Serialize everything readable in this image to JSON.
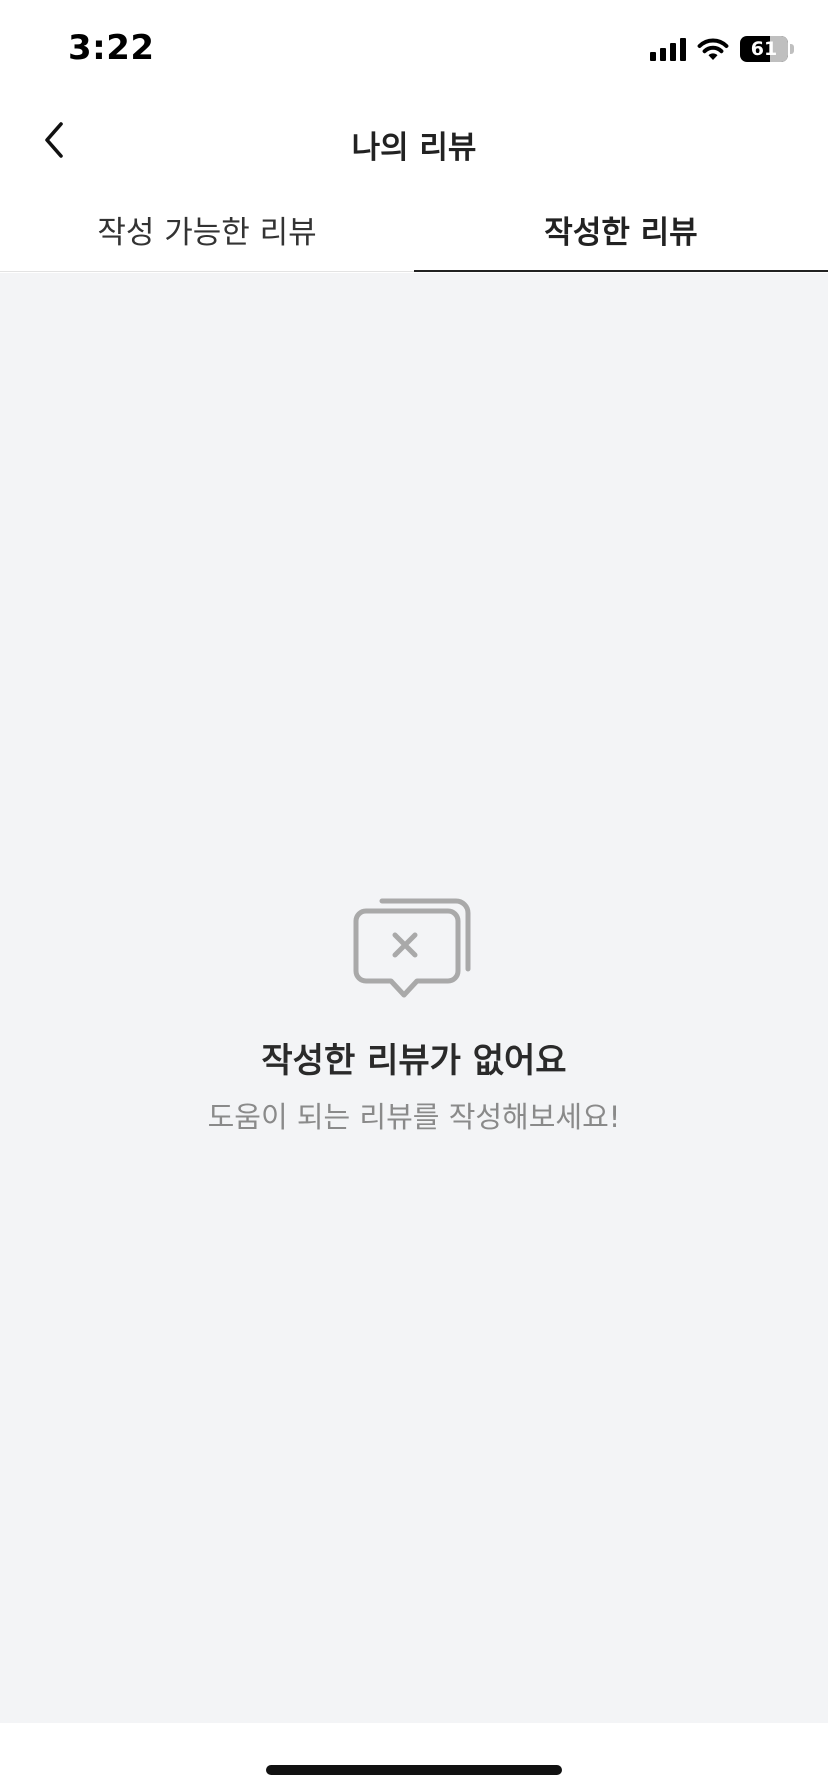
{
  "status_bar": {
    "time": "3:22",
    "battery_level": "61",
    "icons": [
      "cellular-signal-icon",
      "wifi-icon",
      "battery-icon"
    ]
  },
  "header": {
    "title": "나의 리뷰",
    "back_icon": "chevron-left-icon"
  },
  "tabs": [
    {
      "label": "작성 가능한 리뷰",
      "active": false
    },
    {
      "label": "작성한 리뷰",
      "active": true
    }
  ],
  "empty_state": {
    "icon": "chat-bubble-x-icon",
    "title": "작성한 리뷰가 없어요",
    "subtitle": "도움이 되는 리뷰를 작성해보세요!"
  },
  "colors": {
    "content_background": "#f3f4f6",
    "active_tab_indicator": "#222222",
    "subtitle_text": "#8a8a8a"
  }
}
